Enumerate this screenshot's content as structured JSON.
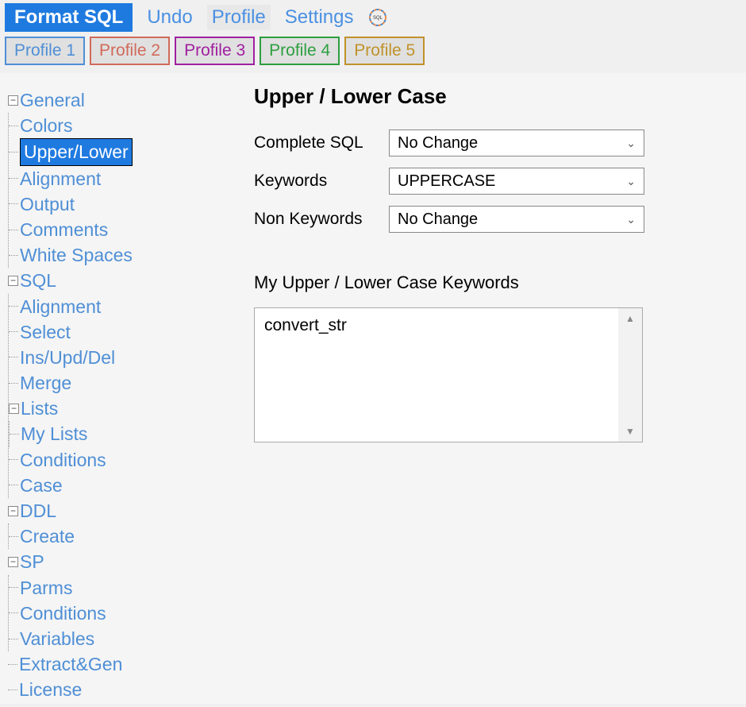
{
  "topbar": {
    "format_btn": "Format SQL",
    "undo": "Undo",
    "profile": "Profile",
    "settings": "Settings"
  },
  "profiles": [
    {
      "label": "Profile 1",
      "color": "#4f8fd6"
    },
    {
      "label": "Profile 2",
      "color": "#d06a5a"
    },
    {
      "label": "Profile 3",
      "color": "#a020a0"
    },
    {
      "label": "Profile 4",
      "color": "#2e9e3f"
    },
    {
      "label": "Profile 5",
      "color": "#c0922a"
    }
  ],
  "tree": {
    "general": {
      "label": "General",
      "children": {
        "colors": "Colors",
        "upperlower": "Upper/Lower",
        "alignment": "Alignment",
        "output": "Output",
        "comments": "Comments",
        "whitespaces": "White Spaces"
      }
    },
    "sql": {
      "label": "SQL",
      "children": {
        "alignment": "Alignment",
        "select": "Select",
        "insupddel": "Ins/Upd/Del",
        "merge": "Merge",
        "lists": {
          "label": "Lists",
          "children": {
            "mylists": "My Lists"
          }
        },
        "conditions": "Conditions",
        "case": "Case"
      }
    },
    "ddl": {
      "label": "DDL",
      "children": {
        "create": "Create"
      }
    },
    "sp": {
      "label": "SP",
      "children": {
        "parms": "Parms",
        "conditions": "Conditions",
        "variables": "Variables"
      }
    },
    "extractgen": {
      "label": "Extract&Gen"
    },
    "license": {
      "label": "License"
    }
  },
  "content": {
    "title": "Upper / Lower Case",
    "rows": {
      "complete_sql": {
        "label": "Complete SQL",
        "value": "No Change"
      },
      "keywords": {
        "label": "Keywords",
        "value": "UPPERCASE"
      },
      "non_keywords": {
        "label": "Non Keywords",
        "value": "No Change"
      }
    },
    "keywords_heading": "My Upper / Lower Case Keywords",
    "keywords_list": [
      "convert_str"
    ]
  },
  "glyphs": {
    "minus": "−",
    "chev": "⌄",
    "up": "▲",
    "down": "▼"
  }
}
